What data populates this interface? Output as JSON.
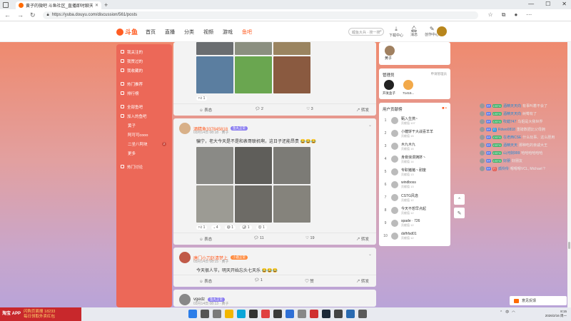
{
  "browser": {
    "tab_title": "黄子的微吧 斗鱼社区_直播即时聊天",
    "url": "https://yuba.douyu.com/discussion/561/posts"
  },
  "header": {
    "logo": "斗鱼",
    "nav": [
      "首页",
      "直播",
      "分类",
      "视频",
      "游戏",
      "鱼吧"
    ],
    "search_placeholder": "鲤鱼大兵 · 搜一搜",
    "icons": [
      {
        "label": "下载中心",
        "icon": "download-icon"
      },
      {
        "label": "消息",
        "icon": "bell-icon",
        "badge": "9"
      },
      {
        "label": "创作中心",
        "icon": "create-icon"
      }
    ],
    "accent": "#ff5d23"
  },
  "leftnav": {
    "items": [
      "我关注的",
      "我赞过的",
      "我收藏的",
      "热门推荐",
      "排行榜",
      "全部鱼吧",
      "加入的鱼吧",
      "黄子",
      "阿可可cooo",
      "二坐八阿块",
      "更多",
      "热门讨论"
    ],
    "badge": "2"
  },
  "posts": [
    {
      "actions": [
        "表态",
        "2",
        "3",
        "转发"
      ],
      "reacts": [
        "1"
      ]
    },
    {
      "user": "酒精鱼337845818",
      "tag": "鱼丸正常",
      "meta": "03月14日 08:18 · 黄子",
      "text": "骗宁，老大今天是不是和表哥联机啊，这日子还能昂贵 😂😂😂",
      "actions": [
        "表态",
        "11",
        "19",
        "转发"
      ],
      "reacts": [
        "1",
        "4",
        "1",
        "1",
        "1"
      ]
    },
    {
      "user": "唐门小刀赵清梦上",
      "tag": "小鹿正常",
      "meta": "03月14日 08:15 · 黄子",
      "text": "今天很人节，明天开始忘头七天乐 😂😂😂",
      "actions": [
        "表态",
        "1",
        "赞",
        "转发"
      ]
    },
    {
      "user": "vgedz",
      "tag": "鱼丸正常",
      "meta": "03月14日 08:13 · 黄子"
    }
  ],
  "right": {
    "top_user": "黄子",
    "managers_title": "管理员",
    "managers_more": "申请管理员",
    "managers": [
      {
        "name": "开发盒子",
        "color": "#222"
      },
      {
        "name": "71415...",
        "color": "#f2a94a"
      }
    ],
    "rank_title": "用户贡献榜",
    "rank": [
      {
        "n": "1",
        "name": "甄入生携~",
        "sub": "贡献值 107"
      },
      {
        "n": "2",
        "name": "小糖饼干大战喜羊羊",
        "sub": "贡献值 15"
      },
      {
        "n": "3",
        "name": "木九木九",
        "sub": "贡献值 15"
      },
      {
        "n": "4",
        "name": "身旁浪漫拥挤丶",
        "sub": "贡献值 14"
      },
      {
        "n": "5",
        "name": "专职猪猪丶耐废",
        "sub": "贡献值 13"
      },
      {
        "n": "6",
        "name": "windboss",
        "sub": "贡献值 13"
      },
      {
        "n": "7",
        "name": "CSTG风逸",
        "sub": "贡献值 12"
      },
      {
        "n": "8",
        "name": "今天不想早点起",
        "sub": "贡献值 12"
      },
      {
        "n": "9",
        "name": "spade · 726",
        "sub": "贡献值 12"
      },
      {
        "n": "10",
        "name": "dsfhfsd01",
        "sub": "贡献值 12"
      }
    ]
  },
  "danmaku": [
    {
      "badge": "FF",
      "level": "CSTG",
      "user": "酒精天天向",
      "text": "有事叫着不会了"
    },
    {
      "badge": "FF",
      "level": "CSTG",
      "user": "酒精天天向",
      "text": "树莓有了"
    },
    {
      "badge": "FF",
      "level": "CSTG",
      "user": "吹蜡747",
      "text": "鸟姐是大我世界"
    },
    {
      "badge": "FF",
      "level": "巴",
      "user": "Rdwo0818",
      "text": "重磅数据比父母拥"
    },
    {
      "badge": "FF",
      "level": "CSTG",
      "user": "在老西CSE",
      "text": "什么玩事、这么胆用"
    },
    {
      "badge": "FF",
      "level": "CSTG",
      "user": "酒精天天",
      "text": "那种吃的亲戚大王"
    },
    {
      "badge": "FF",
      "level": "CSTG",
      "user": "山河剑999",
      "text": "哈哈哈哈哈哈"
    },
    {
      "badge": "FF",
      "level": "CSTG",
      "user": "好朋",
      "text": "好朋友"
    },
    {
      "badge": "FF",
      "level": "巴",
      "user": "孤伶伶",
      "text": "嗯嗯嗯VCL, Michael ?"
    }
  ],
  "feedback": "意见反馈",
  "taskbar": {
    "promo_left": "淘宝 APP",
    "promo_right1": "闪购页面搜 18233",
    "promo_right2": "每日领取外卖红包",
    "time": "8:15",
    "date": "2026/2/16 周一"
  }
}
